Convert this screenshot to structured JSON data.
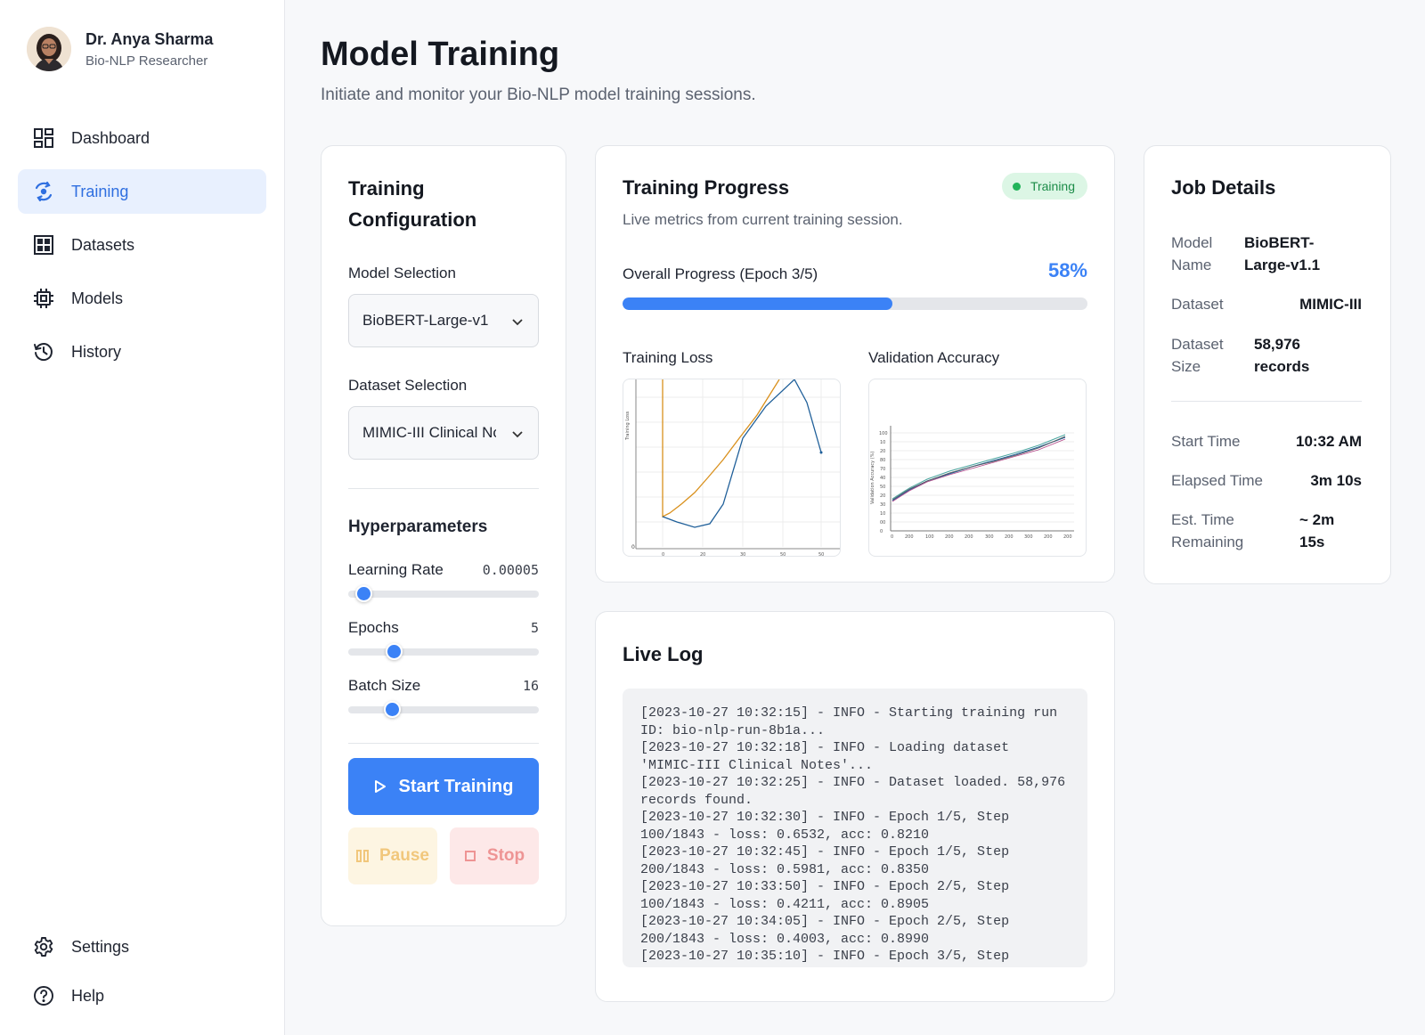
{
  "user": {
    "name": "Dr. Anya Sharma",
    "role": "Bio-NLP Researcher"
  },
  "nav": [
    {
      "label": "Dashboard",
      "icon": "dashboard-icon"
    },
    {
      "label": "Training",
      "icon": "training-icon",
      "active": true
    },
    {
      "label": "Datasets",
      "icon": "datasets-icon"
    },
    {
      "label": "Models",
      "icon": "chip-icon"
    },
    {
      "label": "History",
      "icon": "history-icon"
    }
  ],
  "nav_bottom": [
    {
      "label": "Settings",
      "icon": "gear-icon"
    },
    {
      "label": "Help",
      "icon": "help-icon"
    }
  ],
  "page": {
    "title": "Model Training",
    "subtitle": "Initiate and monitor your Bio-NLP model training sessions."
  },
  "config": {
    "title": "Training Configuration",
    "model_label": "Model Selection",
    "model_value": "BioBERT-Large-v1",
    "dataset_label": "Dataset Selection",
    "dataset_value": "MIMIC-III Clinical Notes",
    "hyper_title": "Hyperparameters",
    "params": [
      {
        "name": "Learning Rate",
        "value": "0.00005",
        "level": 0.08
      },
      {
        "name": "Epochs",
        "value": "5",
        "level": 0.24
      },
      {
        "name": "Batch Size",
        "value": "16",
        "level": 0.23
      }
    ],
    "start_label": "Start Training",
    "pause_label": "Pause",
    "stop_label": "Stop"
  },
  "progress": {
    "title": "Training Progress",
    "subtitle": "Live metrics from current training session.",
    "status": "Training",
    "overall_label": "Overall Progress (Epoch 3/5)",
    "percent_text": "58%",
    "percent": 58,
    "loss_title": "Training Loss",
    "acc_title": "Validation Accuracy",
    "colors": {
      "accent": "#3b82f6",
      "status": "#22b45a",
      "series_orange": "#d9901c",
      "series_blue": "#1f5f99"
    }
  },
  "job": {
    "title": "Job Details",
    "model_name_key": "Model Name",
    "model_name": "BioBERT-Large-v1.1",
    "dataset_key": "Dataset",
    "dataset": "MIMIC-III",
    "dataset_size_key": "Dataset Size",
    "dataset_size": "58,976 records",
    "start_time_key": "Start Time",
    "start_time": "10:32 AM",
    "elapsed_key": "Elapsed Time",
    "elapsed": "3m 10s",
    "remaining_key": "Est. Time Remaining",
    "remaining": "~ 2m 15s"
  },
  "log": {
    "title": "Live Log",
    "lines": [
      "[2023-10-27 10:32:15] - INFO - Starting training run ID: bio-nlp-run-8b1a...",
      "[2023-10-27 10:32:18] - INFO - Loading dataset 'MIMIC-III Clinical Notes'...",
      "[2023-10-27 10:32:25] - INFO - Dataset loaded. 58,976 records found.",
      "[2023-10-27 10:32:30] - INFO - Epoch 1/5, Step 100/1843 - loss: 0.6532, acc: 0.8210",
      "[2023-10-27 10:32:45] - INFO - Epoch 1/5, Step 200/1843 - loss: 0.5981, acc: 0.8350",
      "[2023-10-27 10:33:50] - INFO - Epoch 2/5, Step 100/1843 - loss: 0.4211, acc: 0.8905",
      "[2023-10-27 10:34:05] - INFO - Epoch 2/5, Step 200/1843 - loss: 0.4003, acc: 0.8990",
      "[2023-10-27 10:35:10] - INFO - Epoch 3/5, Step"
    ]
  }
}
